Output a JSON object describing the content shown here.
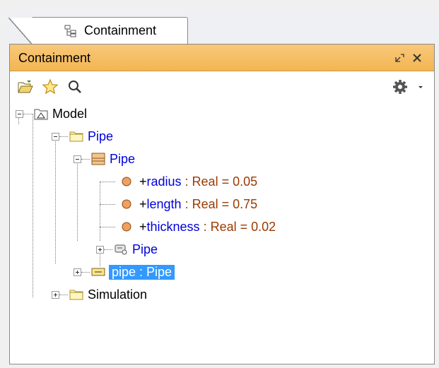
{
  "tab": {
    "label": "Containment"
  },
  "panel": {
    "title": "Containment"
  },
  "tree": {
    "model": "Model",
    "pkg_pipe": "Pipe",
    "block_pipe": "Pipe",
    "props": [
      {
        "prefix": "+",
        "name": "radius",
        "type": " : Real = 0.05"
      },
      {
        "prefix": "+",
        "name": "length",
        "type": " : Real = 0.75"
      },
      {
        "prefix": "+",
        "name": "thickness",
        "type": " : Real = 0.02"
      }
    ],
    "diagram_pipe": "Pipe",
    "part_pipe": "pipe : Pipe",
    "simulation": "Simulation"
  },
  "colors": {
    "header": "#f2b552",
    "link": "#0000dd",
    "selected": "#3399ff"
  }
}
